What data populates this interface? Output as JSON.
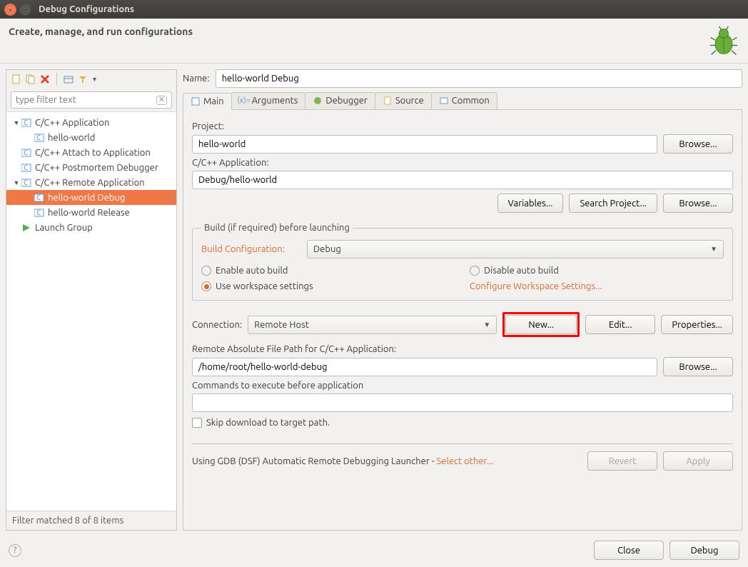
{
  "window": {
    "title": "Debug Configurations"
  },
  "header": {
    "subtitle": "Create, manage, and run configurations"
  },
  "filter": {
    "placeholder": "type filter text"
  },
  "tree": {
    "items": [
      {
        "label": "C/C++ Application",
        "expanded": true,
        "children": [
          {
            "label": "hello-world"
          }
        ]
      },
      {
        "label": "C/C++ Attach to Application",
        "expanded": false,
        "children": []
      },
      {
        "label": "C/C++ Postmortem Debugger",
        "expanded": false,
        "children": []
      },
      {
        "label": "C/C++ Remote Application",
        "expanded": true,
        "children": [
          {
            "label": "hello-world Debug",
            "selected": true
          },
          {
            "label": "hello-world Release"
          }
        ]
      },
      {
        "label": "Launch Group",
        "expanded": false,
        "children": [],
        "launch_group": true
      }
    ]
  },
  "left_footer": "Filter matched 8 of 8 items",
  "name": {
    "label": "Name:",
    "value": "hello-world Debug"
  },
  "tabs": {
    "main": "Main",
    "arguments": "Arguments",
    "debugger": "Debugger",
    "source": "Source",
    "common": "Common"
  },
  "form": {
    "project_label": "Project:",
    "project_value": "hello-world",
    "browse": "Browse...",
    "app_label": "C/C++ Application:",
    "app_value": "Debug/hello-world",
    "variables": "Variables...",
    "search_project": "Search Project...",
    "build_legend": "Build (if required) before launching",
    "build_config_label": "Build Configuration:",
    "build_config_value": "Debug",
    "enable_auto": "Enable auto build",
    "disable_auto": "Disable auto build",
    "use_workspace": "Use workspace settings",
    "configure_workspace": "Configure Workspace Settings...",
    "connection_label": "Connection:",
    "connection_value": "Remote Host",
    "new": "New...",
    "edit": "Edit...",
    "properties": "Properties...",
    "remote_path_label": "Remote Absolute File Path for C/C++ Application:",
    "remote_path_value": "/home/root/hello-world-debug",
    "commands_label": "Commands to execute before application",
    "commands_value": "",
    "skip_download": "Skip download to target path."
  },
  "launcher": {
    "prefix": "Using GDB (DSF) Automatic Remote Debugging Launcher - ",
    "select_other": "Select other...",
    "revert": "Revert",
    "apply": "Apply"
  },
  "bottom": {
    "close": "Close",
    "debug": "Debug"
  }
}
